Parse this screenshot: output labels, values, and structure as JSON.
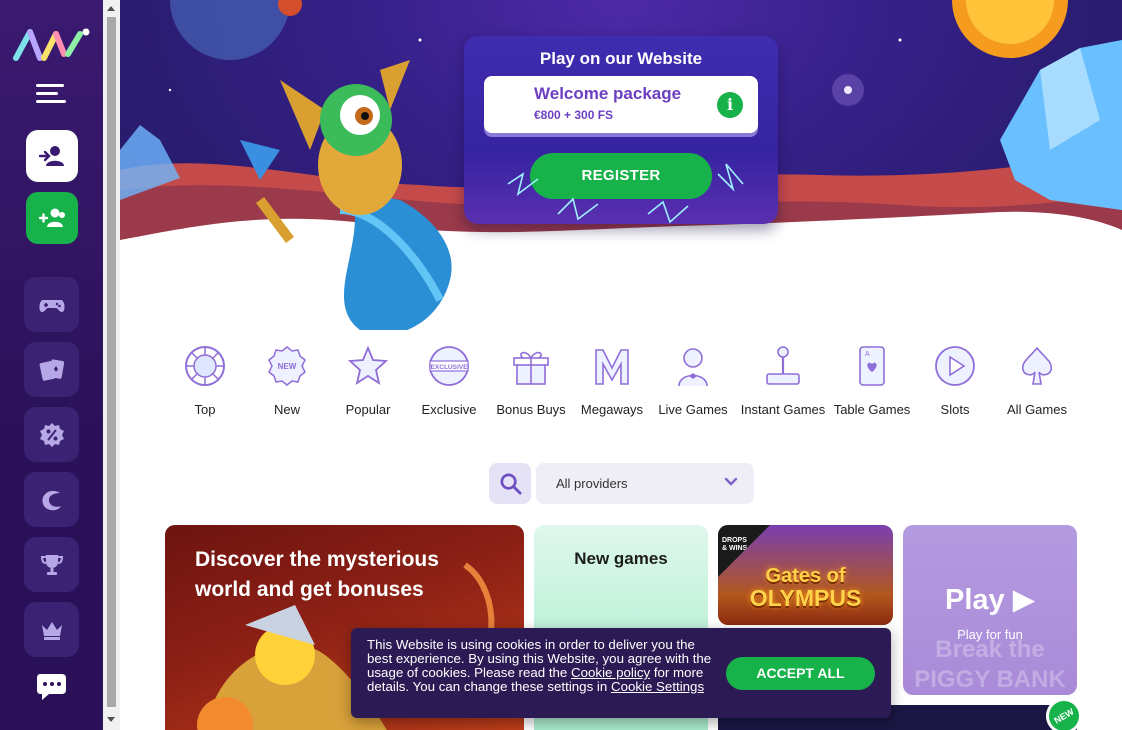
{
  "sidebar": {
    "logo_alt": "logo",
    "items": [
      {
        "name": "login",
        "icon": "user-login-icon"
      },
      {
        "name": "register",
        "icon": "add-users-icon"
      },
      {
        "name": "games",
        "icon": "gamepad-icon"
      },
      {
        "name": "table-games",
        "icon": "cards-icon"
      },
      {
        "name": "promotions",
        "icon": "percent-badge-icon"
      },
      {
        "name": "live",
        "icon": "c-logo-icon"
      },
      {
        "name": "tournaments",
        "icon": "trophy-icon"
      },
      {
        "name": "vip",
        "icon": "crown-icon"
      }
    ]
  },
  "hero": {
    "card_title": "Play on our Website",
    "welcome_title": "Welcome package",
    "welcome_sub": "€800 + 300 FS",
    "info_icon": "i",
    "register_label": "REGISTER"
  },
  "categories": [
    {
      "label": "Top",
      "icon": "top-icon"
    },
    {
      "label": "New",
      "icon": "new-icon"
    },
    {
      "label": "Popular",
      "icon": "star-icon"
    },
    {
      "label": "Exclusive",
      "icon": "exclusive-icon"
    },
    {
      "label": "Bonus Buys",
      "icon": "gift-icon"
    },
    {
      "label": "Megaways",
      "icon": "megaways-icon"
    },
    {
      "label": "Live Games",
      "icon": "dealer-icon"
    },
    {
      "label": "Instant Games",
      "icon": "joystick-icon"
    },
    {
      "label": "Table Games",
      "icon": "playing-card-icon"
    },
    {
      "label": "Slots",
      "icon": "play-circle-icon"
    },
    {
      "label": "All Games",
      "icon": "spade-icon"
    }
  ],
  "filters": {
    "provider_value": "All providers"
  },
  "cards": {
    "discover": "Discover the mysterious world and get bonuses",
    "new_games": "New games",
    "gates_badge": "DROPS & WINS",
    "gates_line1": "Gates of",
    "gates_line2": "OLYMPUS",
    "play_title": "Play",
    "play_sub": "Play for fun",
    "play_ghost": "Break the PIGGY BANK",
    "new_badge": "NEW"
  },
  "cookie": {
    "text_1": "This Website is using cookies in order to deliver you the best experience. By using this Website, you agree with the usage of cookies. Please read the ",
    "link_policy": "Cookie policy",
    "text_2": " for more details. You can change these settings in ",
    "link_settings": "Cookie Settings",
    "accept_label": "ACCEPT ALL"
  },
  "colors": {
    "brand_purple": "#6c3fc2",
    "sidebar_bg": "#2b1159",
    "accent_green": "#18b24a"
  }
}
